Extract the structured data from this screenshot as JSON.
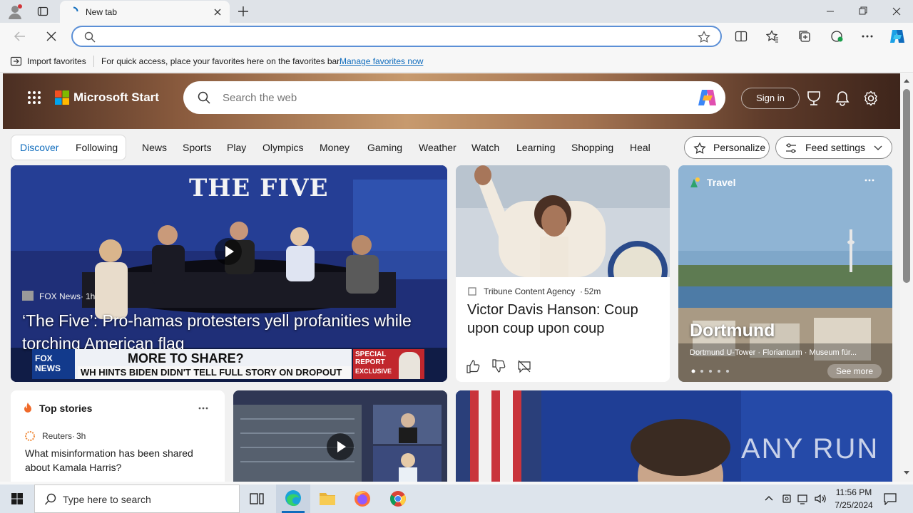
{
  "browser": {
    "tab_title": "New tab",
    "address_value": "",
    "favorites_bar": {
      "import_label": "Import favorites",
      "hint": "For quick access, place your favorites here on the favorites bar.",
      "manage_link": "Manage favorites now"
    }
  },
  "start": {
    "brand": "Microsoft Start",
    "search_placeholder": "Search the web",
    "sign_in": "Sign in",
    "nav": {
      "discover": "Discover",
      "following": "Following",
      "items": [
        "News",
        "Sports",
        "Play",
        "Olympics",
        "Money",
        "Gaming",
        "Weather",
        "Watch",
        "Learning",
        "Shopping",
        "Heal"
      ],
      "personalize": "Personalize",
      "feed_settings": "Feed settings"
    },
    "cards": {
      "main": {
        "source": "FOX News",
        "age": "1h",
        "headline": "‘The Five’: Pro-hamas protesters yell profanities while torching American flag",
        "show_logo": "THE FIVE",
        "chyron_top": "MORE TO SHARE?",
        "chyron_bottom": "WH HINTS BIDEN DIDN'T TELL FULL STORY ON DROPOUT",
        "fox_label": "FOX NEWS",
        "special_label": "SPECIAL REPORT",
        "exclusive_label": "EXCLUSIVE"
      },
      "tribune": {
        "source": "Tribune Content Agency",
        "age": "52m",
        "headline": "Victor Davis Hanson: Coup upon coup upon coup"
      },
      "travel": {
        "category": "Travel",
        "title": "Dortmund",
        "subtitle": "Dortmund U-Tower · Florianturm · Museum für...",
        "see_more": "See more"
      },
      "top_stories": {
        "title": "Top stories",
        "source": "Reuters",
        "age": "3h",
        "headline": "What misinformation has been shared about Kamala Harris?"
      },
      "watermark": "ANY RUN"
    }
  },
  "taskbar": {
    "search_placeholder": "Type here to search",
    "time": "11:56 PM",
    "date": "7/25/2024"
  },
  "colors": {
    "accent": "#0f6cbd",
    "address_border": "#5b8fd6",
    "taskbar": "#dde4ec"
  }
}
